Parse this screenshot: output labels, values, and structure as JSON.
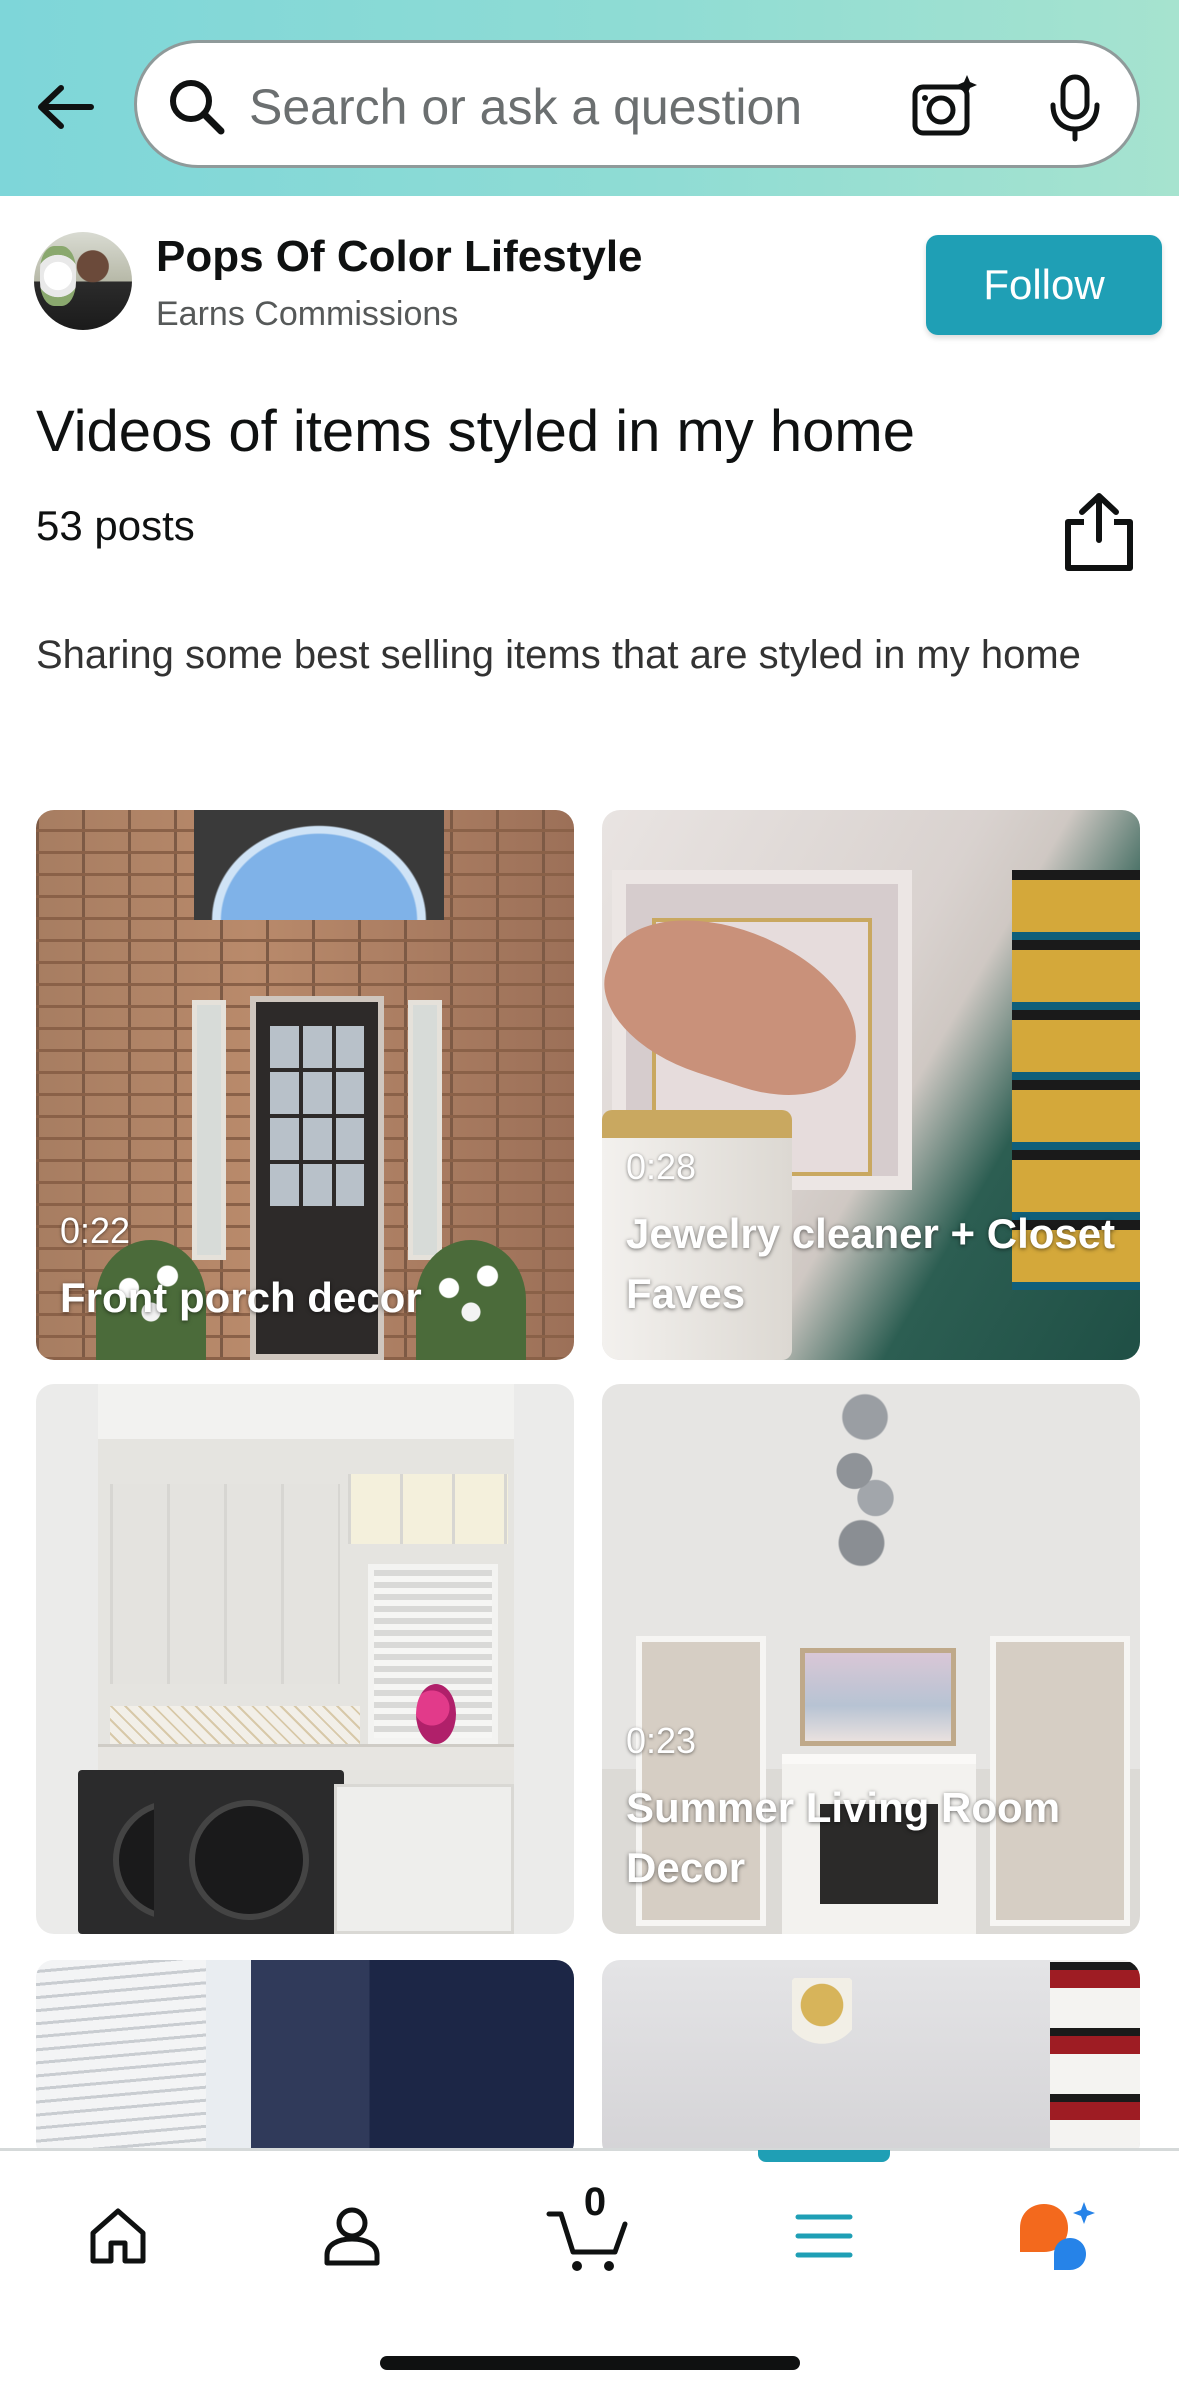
{
  "header": {
    "search_placeholder": "Search or ask a question"
  },
  "creator": {
    "name": "Pops Of Color Lifestyle",
    "subtitle": "Earns Commissions",
    "follow_label": "Follow"
  },
  "collection": {
    "title": "Videos of items styled in my home",
    "posts_count": "53 posts",
    "description": "Sharing some best selling items that are styled in my home"
  },
  "videos": [
    {
      "duration": "0:22",
      "caption": "Front porch decor"
    },
    {
      "duration": "0:28",
      "caption": "Jewelry cleaner + Closet Faves"
    },
    {
      "duration": "",
      "caption": ""
    },
    {
      "duration": "0:23",
      "caption": "Summer Living Room Decor"
    }
  ],
  "bottom_nav": {
    "cart_count": "0",
    "active_index": 3,
    "items": [
      "home-icon",
      "account-icon",
      "cart-icon",
      "menu-icon",
      "rufus-icon"
    ]
  },
  "colors": {
    "accent": "#1f9fb5",
    "header_gradient_start": "#7ed6d9",
    "header_gradient_end": "#a6e3cf"
  }
}
